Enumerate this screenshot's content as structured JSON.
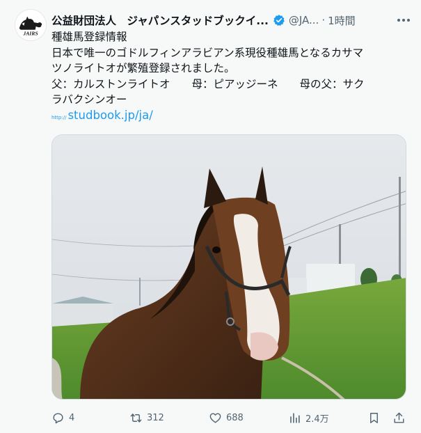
{
  "account": {
    "display_name": "公益財団法人　ジャパンスタッドブックイ...",
    "handle": "@JA...",
    "separator": "·",
    "time": "1時間",
    "avatar_text": "JAIRS",
    "verified_color": "#1d9bf0"
  },
  "post": {
    "lines": [
      "種雄馬登録情報",
      "日本で唯一のゴドルフィンアラビアン系現役種雄馬となるカサマ",
      "ツノライトオが繁殖登録されました。",
      "父：カルストンライトオ　　母：ピアッジーネ　　母の父：サク",
      "ラバクシンオー"
    ],
    "link_prefix": "http://",
    "link_text": "studbook.jp/ja/"
  },
  "media": {
    "description_icon": "horse-photo"
  },
  "actions": {
    "reply_count": "4",
    "repost_count": "312",
    "like_count": "688",
    "views_count": "2.4万"
  },
  "colors": {
    "accent": "#1d9bf0",
    "secondary_text": "#536471",
    "background": "#f7f9f9"
  }
}
